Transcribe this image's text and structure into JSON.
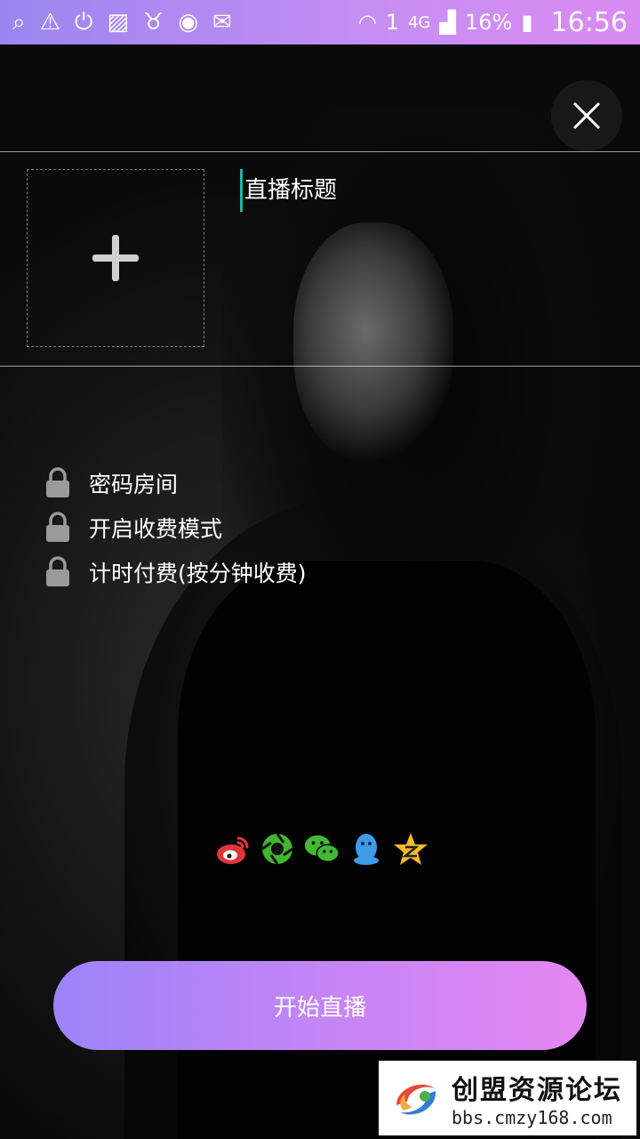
{
  "status_bar": {
    "battery": "16%",
    "time": "16:56",
    "network": "4G",
    "sim": "1"
  },
  "form": {
    "title_placeholder": "直播标题"
  },
  "options": [
    {
      "label": "密码房间"
    },
    {
      "label": "开启收费模式"
    },
    {
      "label": "计时付费(按分钟收费)"
    }
  ],
  "share_icons": [
    "weibo-icon",
    "moments-icon",
    "wechat-icon",
    "qq-icon",
    "qzone-icon"
  ],
  "start_button": {
    "label": "开始直播"
  },
  "watermark": {
    "name": "创盟资源论坛",
    "url": "bbs.cmzy168.com"
  },
  "colors": {
    "accent_start": "#9b84f8",
    "accent_end": "#e487f3",
    "cursor": "#1fb5a5"
  }
}
